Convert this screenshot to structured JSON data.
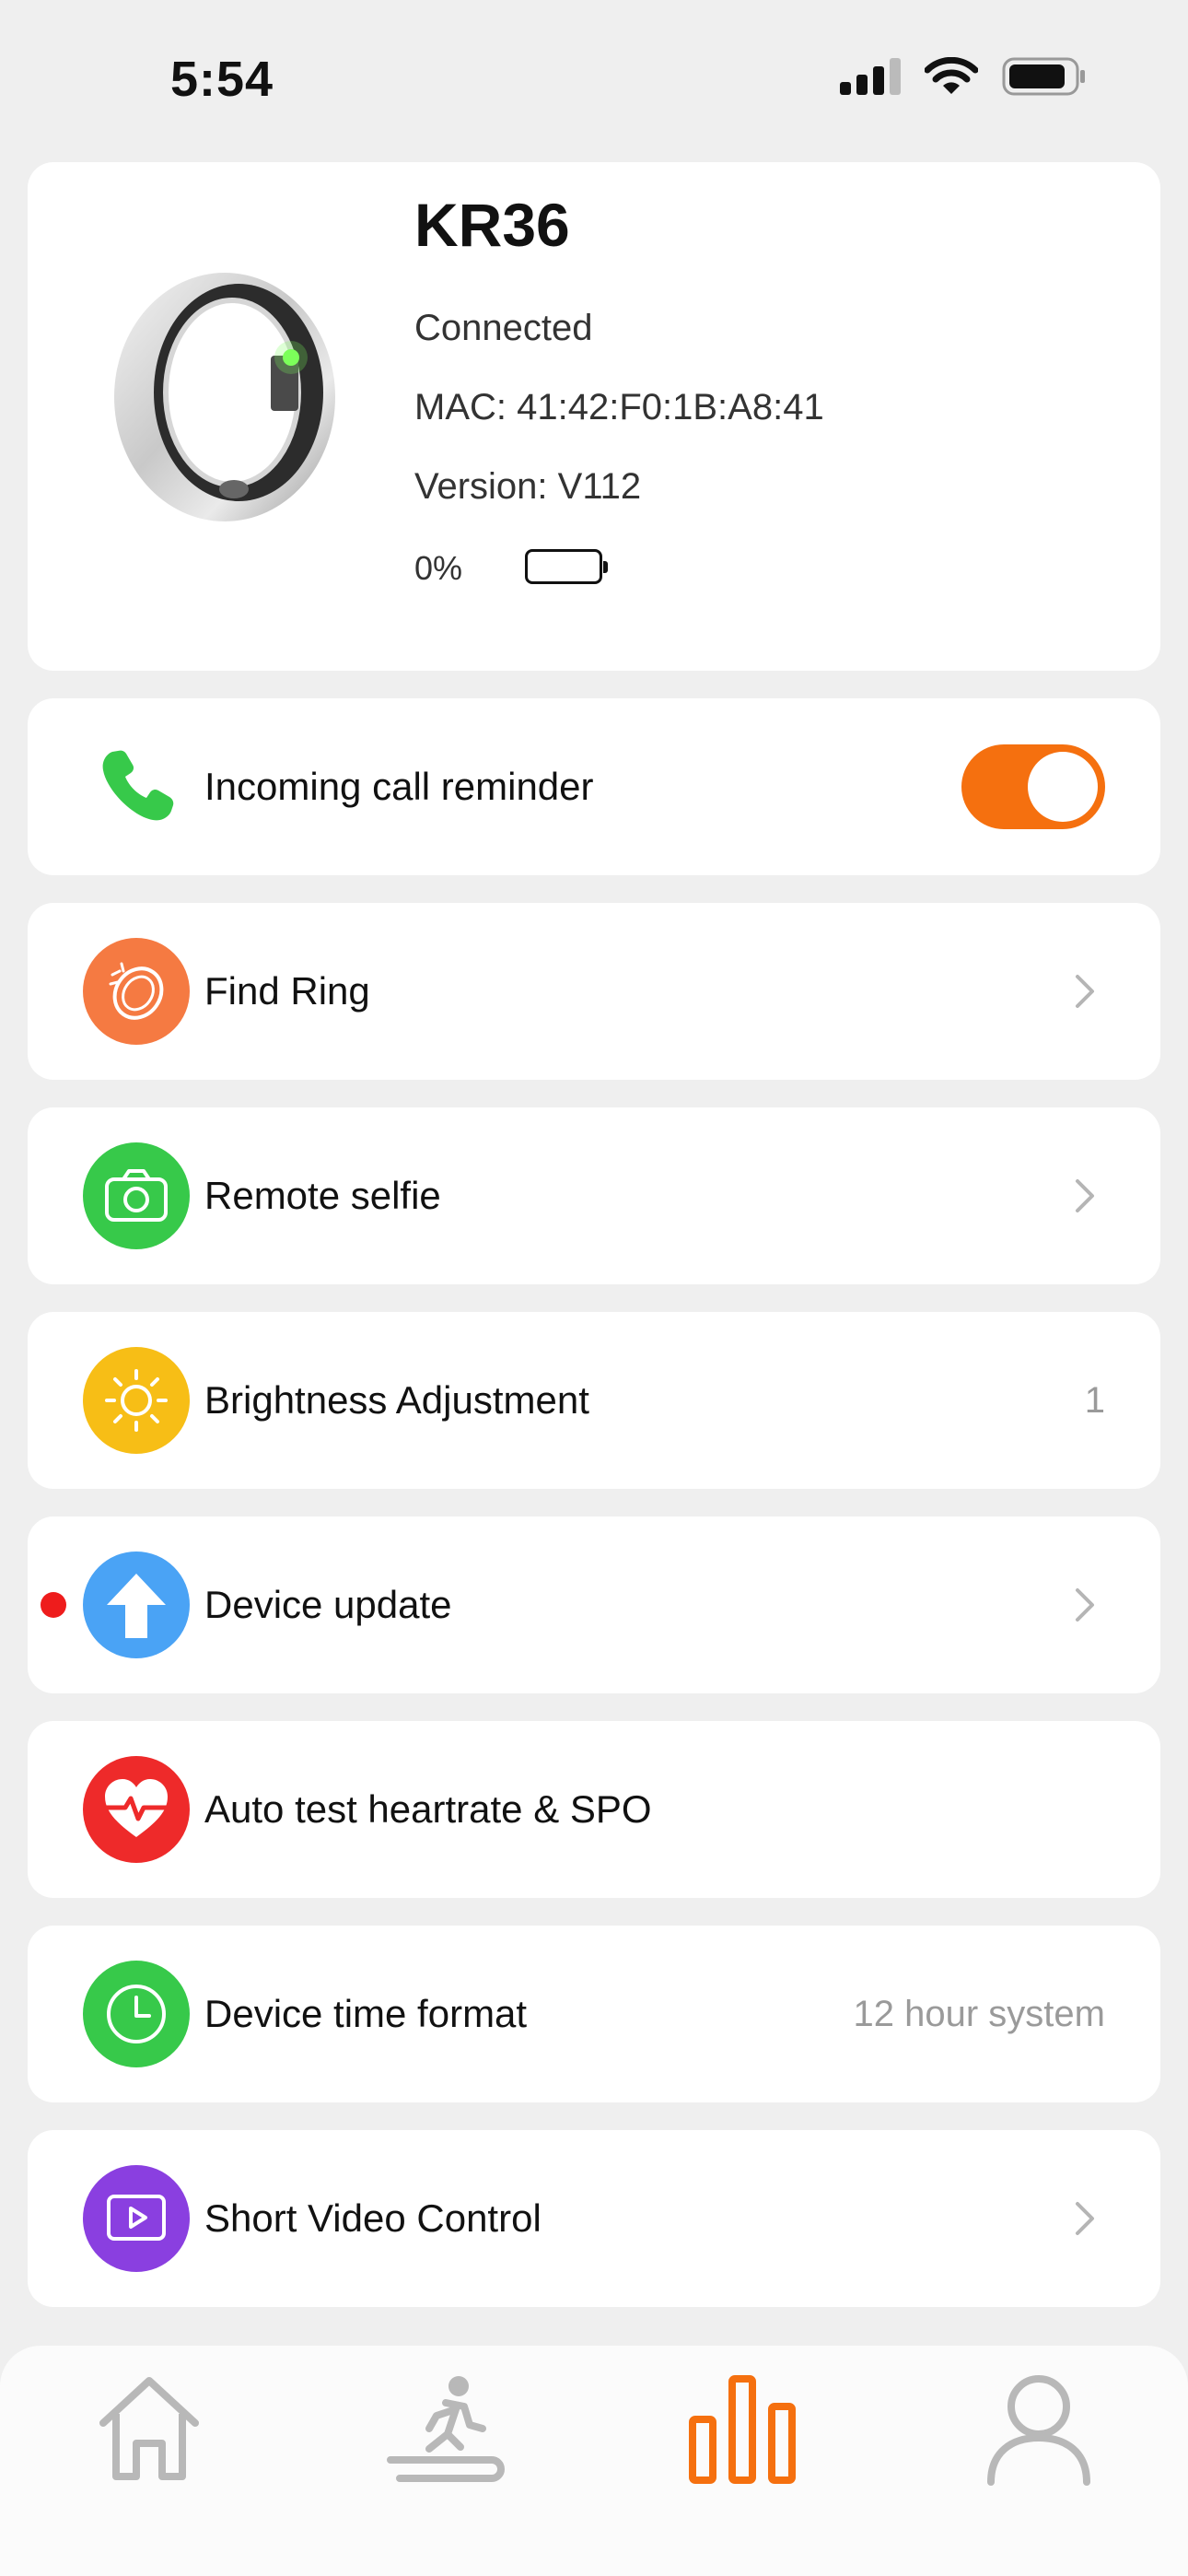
{
  "status_bar": {
    "time": "5:54"
  },
  "device": {
    "name": "KR36",
    "status": "Connected",
    "mac": "MAC: 41:42:F0:1B:A8:41",
    "version": "Version: V112",
    "battery_percent": "0%",
    "battery_level": 0
  },
  "rows": {
    "incoming_call": {
      "label": "Incoming call reminder",
      "enabled": true
    },
    "find_ring": {
      "label": "Find Ring"
    },
    "remote_selfie": {
      "label": "Remote selfie"
    },
    "brightness": {
      "label": "Brightness Adjustment",
      "value": "1"
    },
    "device_update": {
      "label": "Device update",
      "has_notification": true
    },
    "auto_test": {
      "label": "Auto test heartrate & SPO"
    },
    "time_format": {
      "label": "Device time format",
      "value": "12 hour system"
    },
    "short_video": {
      "label": "Short Video Control"
    }
  },
  "tab_bar": {
    "tabs": [
      "home-icon",
      "exercise-icon",
      "stats-icon",
      "profile-icon"
    ],
    "active": "stats-icon"
  },
  "colors": {
    "accent": "#f5700f",
    "find_ring": "#f57a42",
    "selfie": "#37c94a",
    "brightness": "#f7be16",
    "update": "#4aa3f5",
    "heart": "#ee2a2a",
    "time": "#37c94a",
    "video": "#8a3fe0",
    "phone": "#37c94a"
  }
}
